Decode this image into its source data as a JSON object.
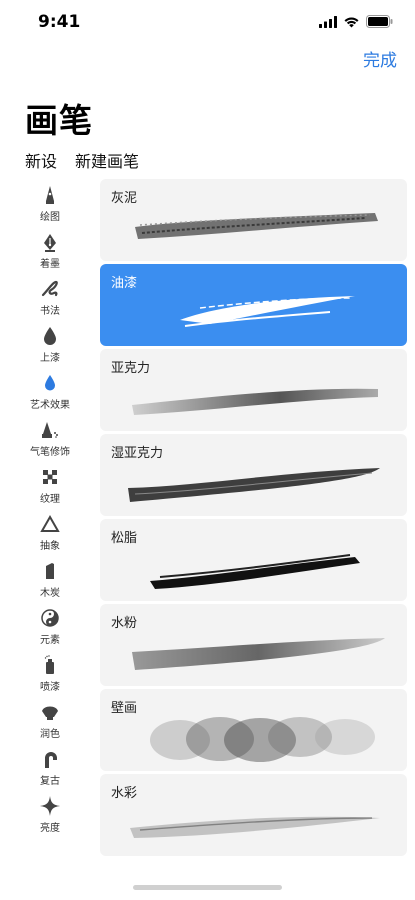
{
  "status": {
    "time": "9:41"
  },
  "header": {
    "done_label": "完成",
    "title": "画笔"
  },
  "actions": {
    "new_set": "新设",
    "new_brush": "新建画笔"
  },
  "sidebar": {
    "items": [
      {
        "label": "绘图",
        "icon": "pencil-tip-icon"
      },
      {
        "label": "着墨",
        "icon": "pen-nib-icon"
      },
      {
        "label": "书法",
        "icon": "calligraphy-squiggle-icon"
      },
      {
        "label": "上漆",
        "icon": "paint-drop-icon"
      },
      {
        "label": "艺术效果",
        "icon": "blue-drop-icon",
        "active": true
      },
      {
        "label": "气笔修饰",
        "icon": "airbrush-icon"
      },
      {
        "label": "纹理",
        "icon": "checker-texture-icon"
      },
      {
        "label": "抽象",
        "icon": "triangle-outline-icon"
      },
      {
        "label": "木炭",
        "icon": "charcoal-stick-icon"
      },
      {
        "label": "元素",
        "icon": "yin-yang-icon"
      },
      {
        "label": "喷漆",
        "icon": "spray-can-icon"
      },
      {
        "label": "润色",
        "icon": "shell-brush-icon"
      },
      {
        "label": "复古",
        "icon": "retro-arch-icon"
      },
      {
        "label": "亮度",
        "icon": "sparkle-star-icon"
      }
    ]
  },
  "brushes": [
    {
      "name": "灰泥"
    },
    {
      "name": "油漆",
      "selected": true
    },
    {
      "name": "亚克力"
    },
    {
      "name": "湿亚克力"
    },
    {
      "name": "松脂"
    },
    {
      "name": "水粉"
    },
    {
      "name": "壁画"
    },
    {
      "name": "水彩"
    }
  ],
  "colors": {
    "accent": "#3b8ef0",
    "link": "#2d7be0",
    "card": "#f3f3f3"
  }
}
